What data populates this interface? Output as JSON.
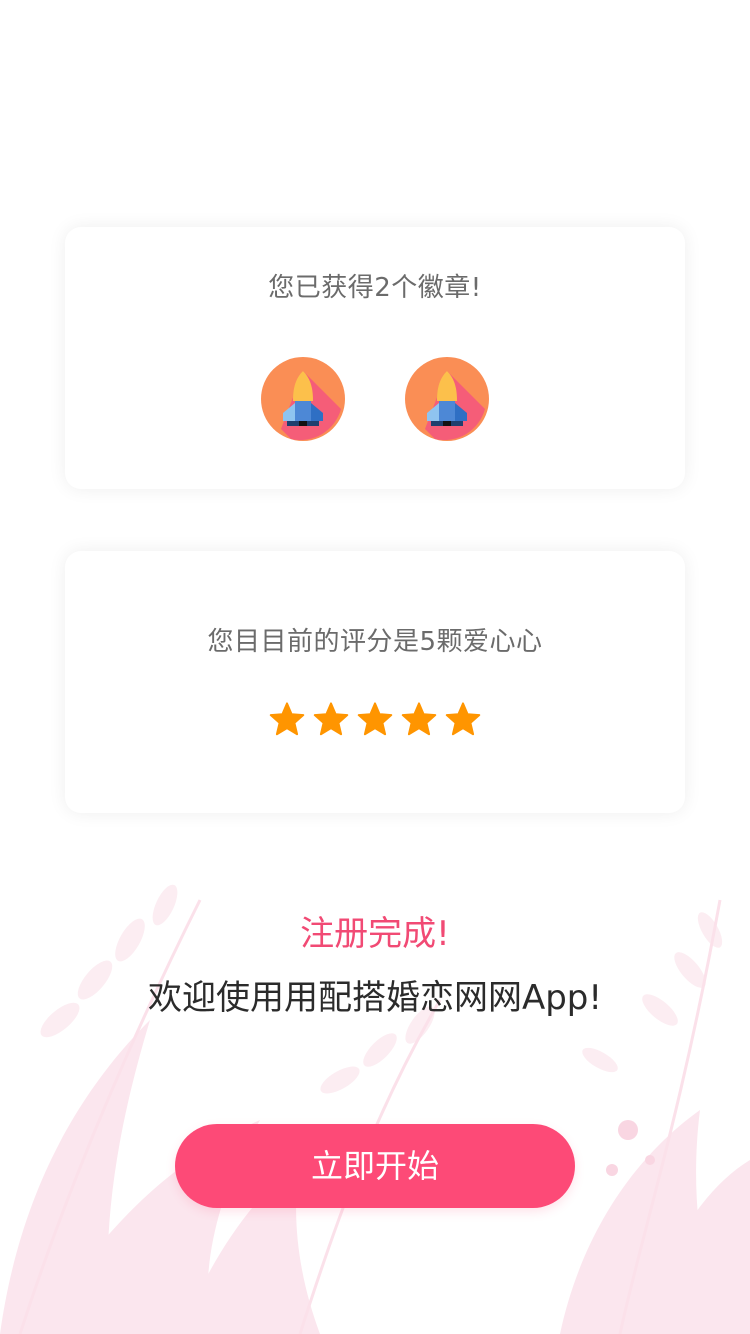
{
  "badges_card": {
    "title": "您已获得2个徽章!",
    "badges": [
      {
        "icon": "rocket-badge-icon"
      },
      {
        "icon": "rocket-badge-icon"
      }
    ]
  },
  "rating_card": {
    "title": "您目目前的评分是5颗爱心心",
    "rating": 5,
    "max_rating": 5
  },
  "completion": {
    "title": "注册完成!",
    "welcome": "欢迎使用用配搭婚恋网网App!"
  },
  "start_button": {
    "label": "立即开始"
  },
  "colors": {
    "accent": "#fd4a77",
    "title_pink": "#f14a74",
    "star": "#ff9500",
    "badge_orange": "#fa8e55"
  }
}
